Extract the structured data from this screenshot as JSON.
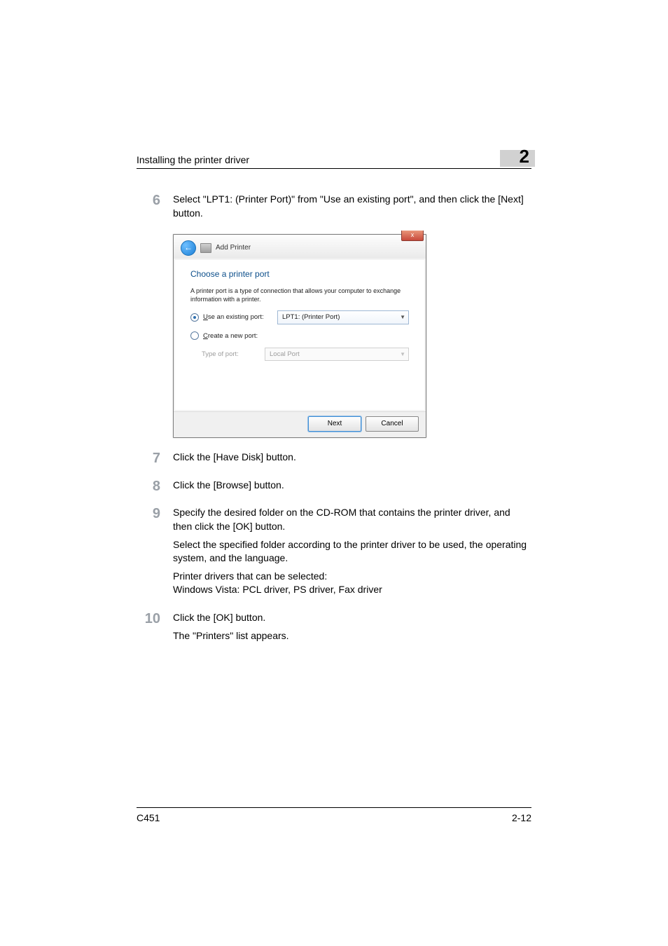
{
  "header": {
    "running_title": "Installing the printer driver",
    "chapter": "2"
  },
  "steps": [
    {
      "num": "6",
      "lines": [
        "Select \"LPT1: (Printer Port)\" from \"Use an existing port\", and then click the [Next] button."
      ],
      "has_dialog": true
    },
    {
      "num": "7",
      "lines": [
        "Click the [Have Disk] button."
      ]
    },
    {
      "num": "8",
      "lines": [
        "Click the [Browse] button."
      ]
    },
    {
      "num": "9",
      "lines": [
        "Specify the desired folder on the CD-ROM that contains the printer driver, and then click the [OK] button.",
        "Select the specified folder according to the printer driver to be used, the operating system, and the language.",
        "Printer drivers that can be selected:",
        "Windows Vista: PCL driver, PS driver, Fax driver"
      ]
    },
    {
      "num": "10",
      "lines": [
        "Click the [OK] button.",
        "The \"Printers\" list appears."
      ]
    }
  ],
  "dialog": {
    "close_glyph": "x",
    "back_glyph": "←",
    "title": "Add Printer",
    "heading": "Choose a printer port",
    "description": "A printer port is a type of connection that allows your computer to exchange information with a printer.",
    "opt_existing": {
      "label_pre": "U",
      "label_rest": "se an existing port:",
      "value": "LPT1: (Printer Port)"
    },
    "opt_create": {
      "label_pre": "C",
      "label_rest": "reate a new port:",
      "type_label": "Type of port:",
      "type_value": "Local Port"
    },
    "next": "Next",
    "cancel": "Cancel"
  },
  "footer": {
    "left": "C451",
    "right": "2-12"
  }
}
